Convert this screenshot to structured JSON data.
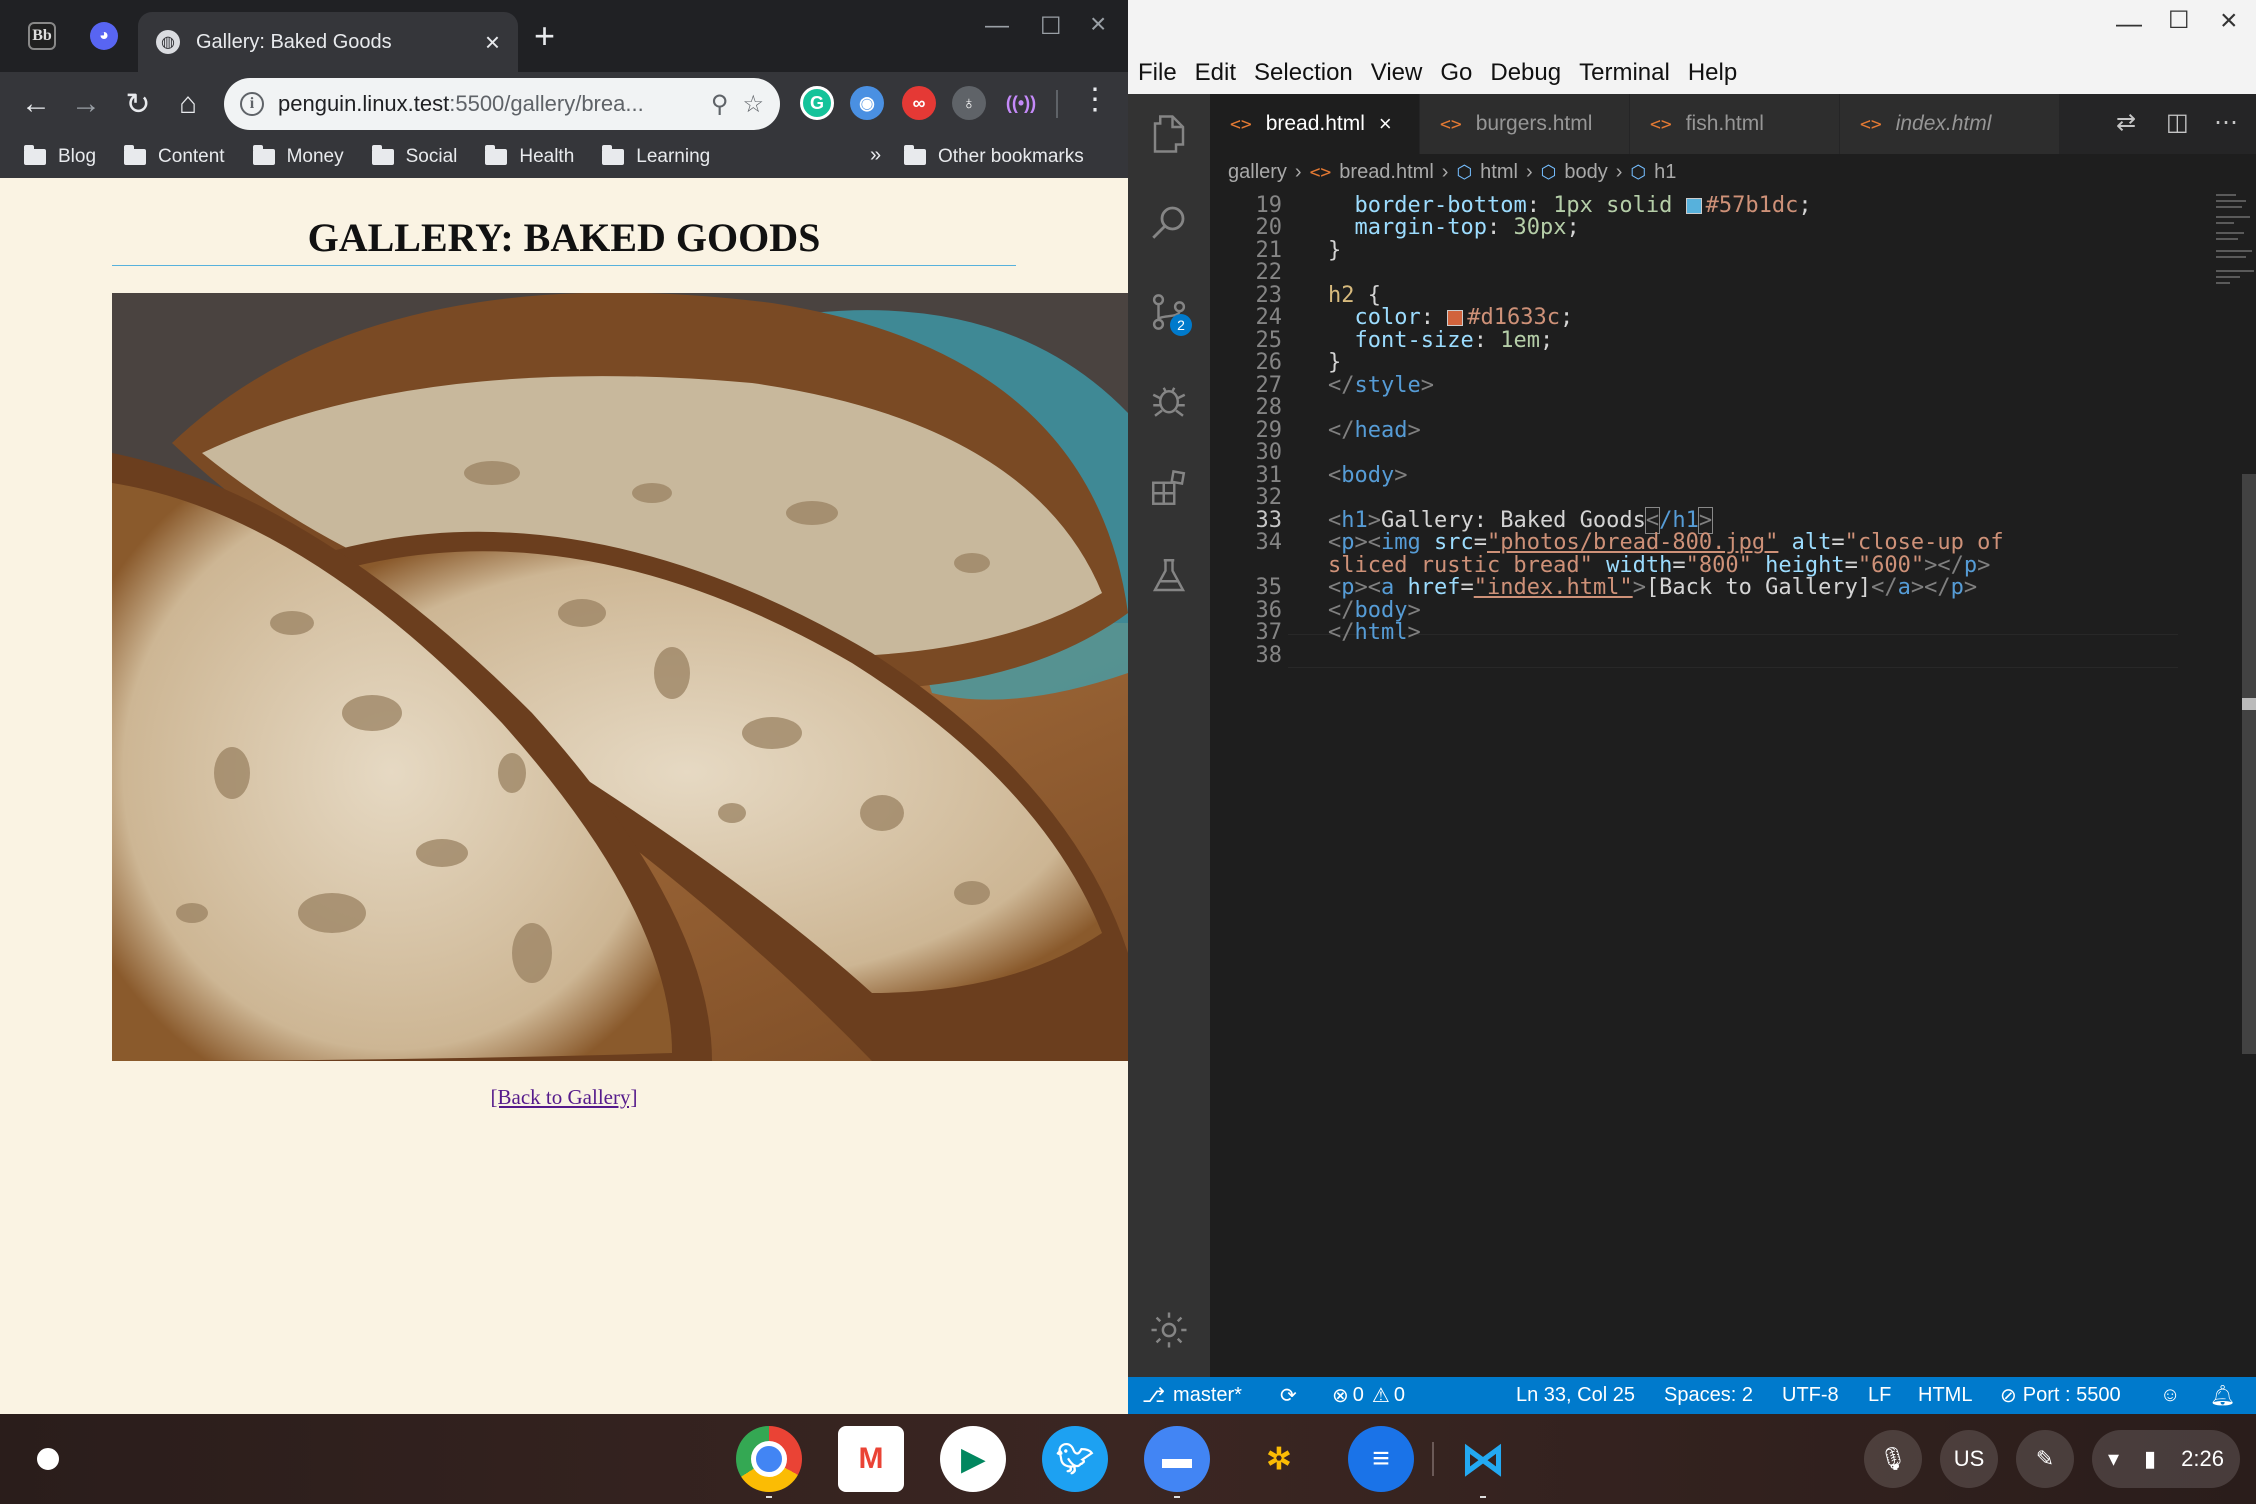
{
  "chrome": {
    "active_tab_title": "Gallery: Baked Goods",
    "url_host": "penguin.linux.test",
    "url_rest": ":5500/gallery/brea...",
    "bookmarks": [
      "Blog",
      "Content",
      "Money",
      "Social",
      "Health",
      "Learning"
    ],
    "bookmarks_overflow": "»",
    "other_bookmarks": "Other bookmarks"
  },
  "page": {
    "heading": "GALLERY: BAKED GOODS",
    "image_alt": "close-up of sliced rustic bread",
    "back_link": "[Back to Gallery]"
  },
  "vscode": {
    "menu": [
      "File",
      "Edit",
      "Selection",
      "View",
      "Go",
      "Debug",
      "Terminal",
      "Help"
    ],
    "tabs": [
      {
        "label": "bread.html",
        "active": true
      },
      {
        "label": "burgers.html",
        "active": false
      },
      {
        "label": "fish.html",
        "active": false
      },
      {
        "label": "index.html",
        "active": false,
        "preview": true
      }
    ],
    "breadcrumbs": [
      "gallery",
      "bread.html",
      "html",
      "body",
      "h1"
    ],
    "scm_badge": "2",
    "line_numbers": [
      "19",
      "20",
      "21",
      "22",
      "23",
      "24",
      "25",
      "26",
      "27",
      "28",
      "29",
      "30",
      "31",
      "32",
      "33",
      "34",
      "",
      "35",
      "36",
      "37",
      "38"
    ],
    "code": {
      "l19_prop": "border-bottom",
      "l19_val": "1px solid ",
      "l19_color": "#57b1dc",
      "l20_prop": "margin-top",
      "l20_val": "30px",
      "l21": "}",
      "l23_sel": "h2",
      "l24_prop": "color",
      "l24_color": "#d1633c",
      "l25_prop": "font-size",
      "l25_val": "1em",
      "l26": "}",
      "l27_tag": "style",
      "l29_tag": "head",
      "l31_tag": "body",
      "l33_text": "Gallery: Baked Goods",
      "l34_src": "\"photos/bread-800.jpg\"",
      "l34_alt_a": "\"close-up of",
      "l34_alt_b": "sliced rustic bread\"",
      "l34_width": "\"800\"",
      "l34_height": "\"600\"",
      "l35_href": "\"index.html\"",
      "l35_text": "[Back to Gallery]",
      "l36_tag": "body",
      "l37_tag": "html"
    },
    "status": {
      "branch": "master*",
      "errors": "0",
      "warnings": "0",
      "position": "Ln 33, Col 25",
      "spaces": "Spaces: 2",
      "encoding": "UTF-8",
      "eol": "LF",
      "language": "HTML",
      "port": "Port : 5500"
    }
  },
  "shelf": {
    "ime": "US",
    "time": "2:26"
  }
}
